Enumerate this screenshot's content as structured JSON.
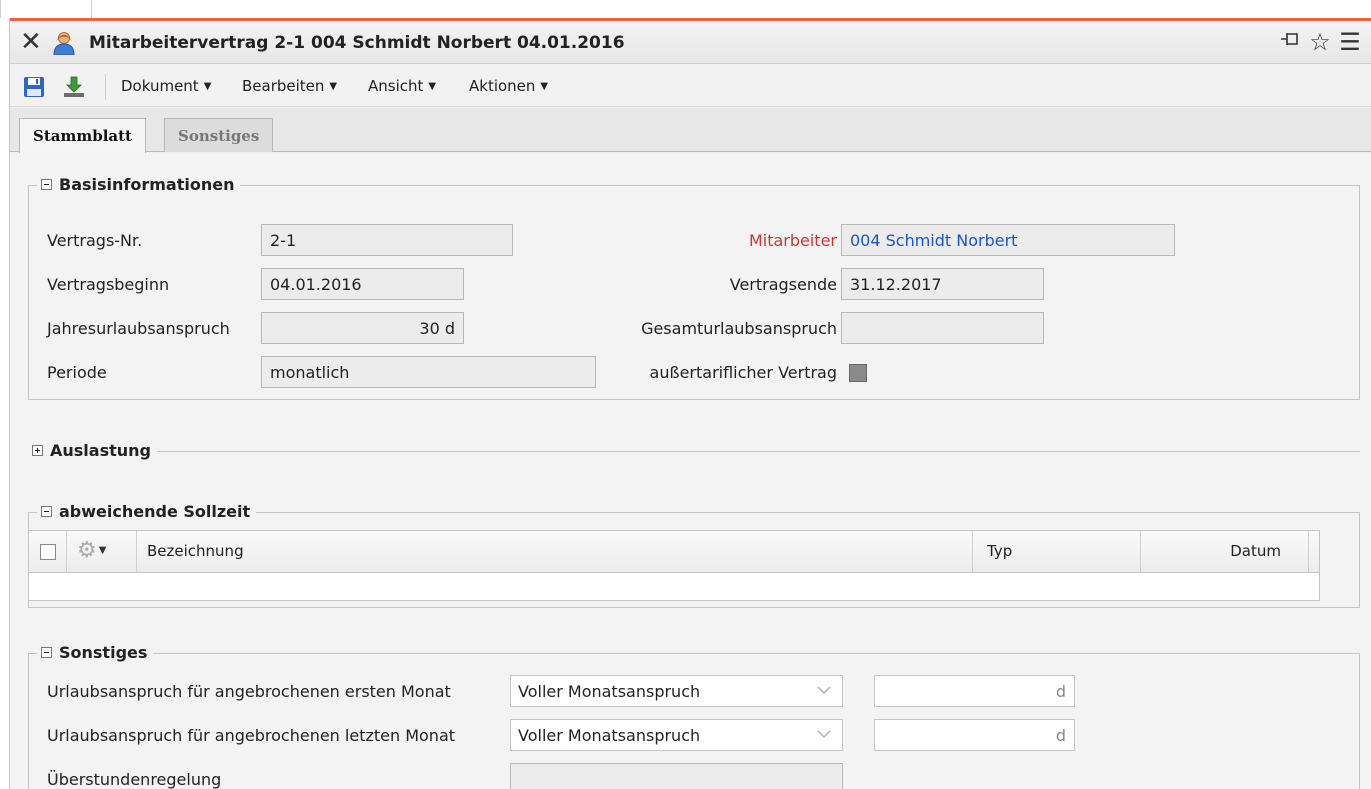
{
  "window": {
    "title": "Mitarbeitervertrag 2-1 004 Schmidt Norbert 04.01.2016",
    "accent_color": "#e8673f",
    "title_icons": [
      "pin-icon",
      "star-icon",
      "menu-icon"
    ]
  },
  "toolbar": {
    "menus": [
      {
        "label": "Dokument"
      },
      {
        "label": "Bearbeiten"
      },
      {
        "label": "Ansicht"
      },
      {
        "label": "Aktionen"
      }
    ]
  },
  "tabs": [
    {
      "label": "Stammblatt",
      "active": true
    },
    {
      "label": "Sonstiges",
      "active": false
    }
  ],
  "basis": {
    "legend": "Basisinformationen",
    "vertragsnr_label": "Vertrags-Nr.",
    "vertragsnr_value": "2-1",
    "mitarbeiter_label": "Mitarbeiter",
    "mitarbeiter_value": "004 Schmidt Norbert",
    "beginn_label": "Vertragsbeginn",
    "beginn_value": "04.01.2016",
    "ende_label": "Vertragsende",
    "ende_value": "31.12.2017",
    "jahresurlaub_label": "Jahresurlaubsanspruch",
    "jahresurlaub_value": "30 d",
    "gesamturlaub_label": "Gesamturlaubsanspruch",
    "gesamturlaub_value": "",
    "periode_label": "Periode",
    "periode_value": "monatlich",
    "aussertariflich_label": "außertariflicher Vertrag",
    "aussertariflich_checked": false
  },
  "auslastung": {
    "legend": "Auslastung"
  },
  "sollzeit": {
    "legend": "abweichende Sollzeit",
    "columns": [
      "Bezeichnung",
      "Typ",
      "Datum"
    ],
    "rows": []
  },
  "sonstiges": {
    "legend": "Sonstiges",
    "erster_label": "Urlaubsanspruch für angebrochenen ersten Monat",
    "erster_value": "Voller Monatsanspruch",
    "erster_days_unit": "d",
    "letzter_label": "Urlaubsanspruch für angebrochenen letzten Monat",
    "letzter_value": "Voller Monatsanspruch",
    "letzter_days_unit": "d",
    "ueberstunden_label": "Überstundenregelung",
    "ueberstunden_value": ""
  }
}
